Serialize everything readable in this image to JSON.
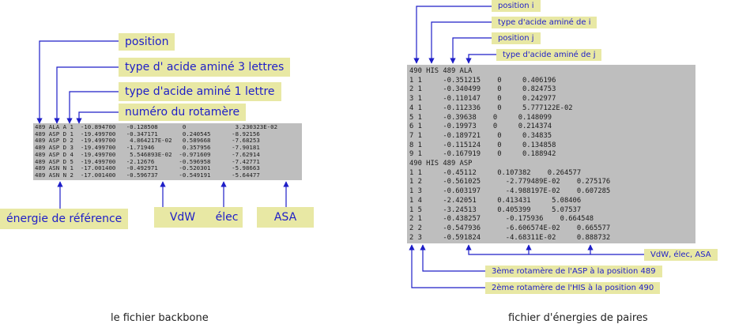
{
  "left": {
    "caption": "le fichier backbone",
    "labels": {
      "position": "position",
      "aa3": "type d' acide aminé 3 lettres",
      "aa1": "type d'acide aminé 1 lettre",
      "rot": "numéro du rotamère",
      "eref": "énergie de référence",
      "vdw": "VdW",
      "elec": "élec",
      "asa": "ASA"
    },
    "rows": [
      "489 ALA A 1  -10.894700   -0.128508       0              3.230323E-02",
      "489 ASP D 1  -19.499700   -0.347171       0.240545      -8.92156",
      "489 ASP D 2  -19.499700    4.864217E-02   0.589668      -7.68253",
      "489 ASP D 3  -19.499700   -1.71946        0.357956      -7.90181",
      "489 ASP D 4  -19.499700    5.546893E-02  -0.971609      -7.62914",
      "489 ASP D 5  -19.499700   -2.12676       -0.596958      -7.42771",
      "489 ASN N 1  -17.001400   -0.492971      -0.520301      -5.98663",
      "489 ASN N 2  -17.001400   -0.596737      -0.549191      -5.64477"
    ]
  },
  "right": {
    "caption": "fichier d'énergies de paires",
    "labels": {
      "posi": "position i",
      "aai": "type  d'acide aminé de i",
      "posj": "position j",
      "aaj": "type d'acide aminé de j",
      "energies": "VdW,  élec,  ASA",
      "rot_asp": "3ème  rotamère de l'ASP à la position 489",
      "rot_his": "2ème  rotamère de l'HIS à la position 490"
    },
    "rows": [
      "490 HIS 489 ALA",
      "1 1     -0.351215    0     0.406196",
      "2 1     -0.340499    0     0.824753",
      "3 1     -0.110147    0     0.242977",
      "4 1     -0.112336    0     5.777122E-02",
      "5 1     -0.39638    0     0.148099",
      "6 1     -0.19973    0     0.214374",
      "7 1     -0.189721    0     0.34835",
      "8 1     -0.115124    0     0.134858",
      "9 1     -0.167919    0     0.188942",
      "490 HIS 489 ASP",
      "1 1     -0.45112     0.107382    0.264577",
      "1 2     -0.561025      -2.779489E-02    0.275176",
      "1 3     -0.603197      -4.988197E-02    0.607285",
      "1 4     -2.42051     0.413431     5.08406",
      "1 5     -3.24513     0.405399     5.07537",
      "2 1     -0.438257      -0.175936    0.664548",
      "2 2     -0.547936      -6.606574E-02    0.665577",
      "2 3     -0.591824      -4.68311E-02     0.888732"
    ]
  },
  "colors": {
    "label_bg": "#e8e8a4",
    "label_text": "#1e1ec8",
    "panel_bg": "#bebebe",
    "arrow": "#1e1ec8"
  }
}
